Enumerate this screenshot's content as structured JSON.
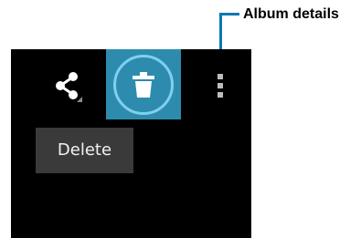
{
  "callout": {
    "label": "Album details",
    "line_color": "#0a78b5"
  },
  "toolbar": {
    "background": "#000000",
    "buttons": [
      {
        "name": "share",
        "icon": "share-icon",
        "highlighted": false
      },
      {
        "name": "delete",
        "icon": "trash-icon",
        "highlighted": true,
        "highlight_color": "#2d8cad"
      },
      {
        "name": "overflow-menu",
        "icon": "more-vertical-icon",
        "highlighted": false
      }
    ]
  },
  "tooltip": {
    "text": "Delete"
  }
}
